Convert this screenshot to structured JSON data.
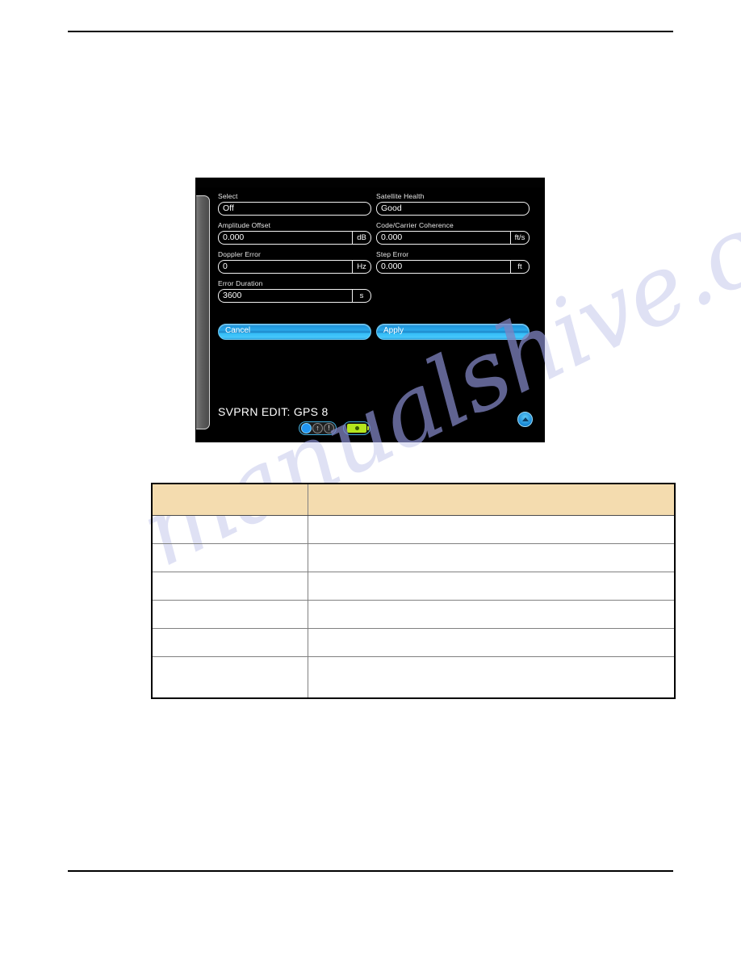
{
  "document": {
    "watermark_text": "manualshive.com"
  },
  "device_screen": {
    "title": "SVPRN EDIT: GPS 8",
    "fields": [
      {
        "label": "Select",
        "value": "Off",
        "unit": "",
        "name": "select"
      },
      {
        "label": "Satellite Health",
        "value": "Good",
        "unit": "",
        "name": "satellite-health"
      },
      {
        "label": "Amplitude Offset",
        "value": "0.000",
        "unit": "dB",
        "name": "amplitude-offset"
      },
      {
        "label": "Code/Carrier Coherence",
        "value": "0.000",
        "unit": "ft/s",
        "name": "code-carrier-coherence"
      },
      {
        "label": "Doppler Error",
        "value": "0",
        "unit": "Hz",
        "name": "doppler-error"
      },
      {
        "label": "Step Error",
        "value": "0.000",
        "unit": "ft",
        "name": "step-error"
      },
      {
        "label": "Error Duration",
        "value": "3600",
        "unit": "s",
        "name": "error-duration"
      }
    ],
    "buttons": {
      "cancel": "Cancel",
      "apply": "Apply"
    },
    "status_icons": {
      "indicator": "status-circle-icon",
      "up_arrow": "↑",
      "alert": "!",
      "battery": "battery-icon"
    },
    "nav_button": "up-chevron-icon",
    "colors": {
      "screen_background": "#000000",
      "button_accent": "#2aa8ea",
      "battery_green": "#b5e61d",
      "indicator_blue": "#2196f3"
    }
  },
  "table": {
    "columns": [
      "",
      ""
    ],
    "header": [
      "",
      ""
    ],
    "rows": [
      [
        "",
        ""
      ],
      [
        "",
        ""
      ],
      [
        "",
        ""
      ],
      [
        "",
        ""
      ],
      [
        "",
        ""
      ],
      [
        "",
        ""
      ]
    ],
    "header_color": "#f4dcaf"
  }
}
